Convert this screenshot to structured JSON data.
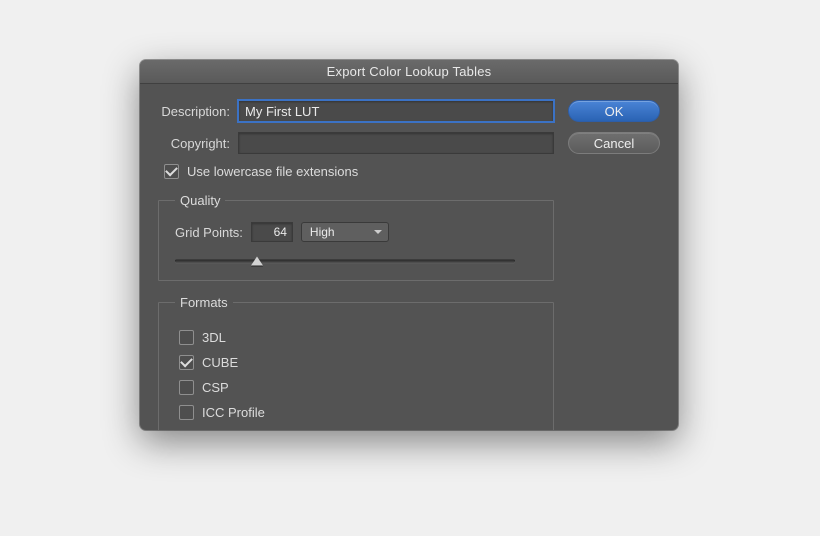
{
  "title": "Export Color Lookup Tables",
  "buttons": {
    "ok": "OK",
    "cancel": "Cancel"
  },
  "fields": {
    "description": {
      "label": "Description:",
      "value": "My First LUT"
    },
    "copyright": {
      "label": "Copyright:",
      "value": ""
    }
  },
  "lowercase": {
    "label": "Use lowercase file extensions",
    "checked": true
  },
  "quality": {
    "legend": "Quality",
    "grid_label": "Grid Points:",
    "grid_points": "64",
    "preset": "High",
    "slider_percent": 24
  },
  "formats": {
    "legend": "Formats",
    "items": [
      {
        "label": "3DL",
        "checked": false
      },
      {
        "label": "CUBE",
        "checked": true
      },
      {
        "label": "CSP",
        "checked": false
      },
      {
        "label": "ICC Profile",
        "checked": false
      }
    ]
  }
}
